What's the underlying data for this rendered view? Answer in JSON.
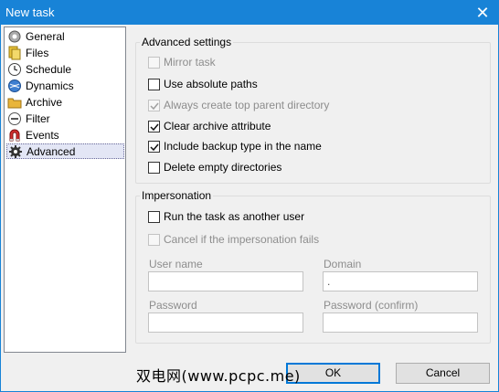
{
  "window": {
    "title": "New task",
    "close_glyph": "✕"
  },
  "sidebar": {
    "items": [
      {
        "label": "General",
        "icon": "gear-person-icon"
      },
      {
        "label": "Files",
        "icon": "files-icon"
      },
      {
        "label": "Schedule",
        "icon": "clock-icon"
      },
      {
        "label": "Dynamics",
        "icon": "globe-icon"
      },
      {
        "label": "Archive",
        "icon": "folder-icon"
      },
      {
        "label": "Filter",
        "icon": "filter-icon"
      },
      {
        "label": "Events",
        "icon": "magnet-icon"
      },
      {
        "label": "Advanced",
        "icon": "advanced-gear-icon",
        "selected": true
      }
    ]
  },
  "advanced": {
    "group_title": "Advanced settings",
    "options": [
      {
        "label": "Mirror task",
        "checked": false,
        "disabled": true
      },
      {
        "label": "Use absolute paths",
        "checked": false,
        "disabled": false
      },
      {
        "label": "Always create top parent directory",
        "checked": true,
        "disabled": true
      },
      {
        "label": "Clear archive attribute",
        "checked": true,
        "disabled": false
      },
      {
        "label": "Include backup type in the name",
        "checked": true,
        "disabled": false
      },
      {
        "label": "Delete empty directories",
        "checked": false,
        "disabled": false
      }
    ]
  },
  "impersonation": {
    "group_title": "Impersonation",
    "run_as_other_user": {
      "label": "Run the task as another user",
      "checked": false,
      "disabled": false
    },
    "cancel_if_fails": {
      "label": "Cancel if the impersonation fails",
      "checked": false,
      "disabled": true
    },
    "user_name": {
      "label": "User name",
      "value": ""
    },
    "domain": {
      "label": "Domain",
      "value": "."
    },
    "password": {
      "label": "Password",
      "value": ""
    },
    "password_confirm": {
      "label": "Password (confirm)",
      "value": ""
    }
  },
  "buttons": {
    "ok": "OK",
    "cancel": "Cancel"
  },
  "watermark": "双电网(www.pcpc.me)",
  "colors": {
    "titlebar": "#1883d7",
    "selection": "#e3e6f5",
    "default_button_border": "#0078d7"
  }
}
